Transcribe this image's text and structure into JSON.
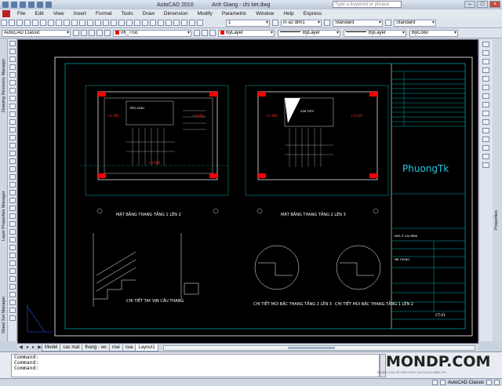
{
  "window": {
    "app_title": "AutoCAD 2010",
    "document_title": "Anh Giang - chi tiet.dwg",
    "search_placeholder": "Type a keyword or phrase"
  },
  "menu": [
    "File",
    "Edit",
    "View",
    "Insert",
    "Format",
    "Tools",
    "Draw",
    "Dimension",
    "Modify",
    "Parametric",
    "Window",
    "Help",
    "Express"
  ],
  "toolbar1": {
    "scale_combo": "1",
    "dimstyle_combo": "in a2 dim1",
    "textstyle_combo": "Standard",
    "tablestyle_combo": "Standard"
  },
  "toolbar2": {
    "workspace": "AutoCAD Classic",
    "layer": "06_Truc",
    "color": "ByLayer",
    "linetype": "ByLayer",
    "lineweight": "ByLayer",
    "plotstyle": "ByColor"
  },
  "left_palettes": [
    "Drawing Recovery Manager",
    "Layer Properties Manager",
    "Sheet Set Manager"
  ],
  "right_palettes": [
    "Properties"
  ],
  "layout_tabs": [
    "Model",
    "cac mat",
    "thang - wc",
    "mai",
    "cua",
    "Layout1"
  ],
  "active_tab": "Layout1",
  "command_lines": [
    "Command:",
    "Command:",
    "Command:"
  ],
  "watermark": {
    "main": "MONDP.COM",
    "sub": "TRANG CHIA SẺ KIẾN THỨC AUTOCAD MIỄN PHÍ"
  },
  "status": {
    "workspace_label": "AutoCAD Classic",
    "coords": ""
  },
  "sheet": {
    "plan1_title": "MẶT BẰNG THANG TẦNG 1 LÊN 2",
    "plan2_title": "MẶT BẰNG THANG TẦNG 2 LÊN 3",
    "detail_rail_title": "CHI TIẾT TAY VỊN CẦU THANG",
    "detail_nose2_title": "CHI TIẾT MŨI BẬC THANG TẦNG 2 LÊN 3",
    "detail_nose1_title": "CHI TIẾT MŨI BẬC THANG TẦNG 1 LÊN 2",
    "logo": "PhuongTk",
    "house_label": "NHÀ Ở GIA ĐÌNH",
    "drawing_label": "MB THANG",
    "sheet_no": "CT-01",
    "level_1": "+0.000",
    "level_2": "+2.100",
    "level_3": "+4.650",
    "level_4": "+3.150",
    "room_1": "TIỀN SẢNH",
    "room_2": "SÂN TRỜI",
    "axis_labels": [
      "A",
      "B",
      "2",
      "3"
    ]
  },
  "colors": {
    "canvas": "#000000",
    "frame": "#ffffff",
    "dimension": "#00d0d0",
    "column": "#ff0000",
    "logo": "#20c8e0"
  }
}
